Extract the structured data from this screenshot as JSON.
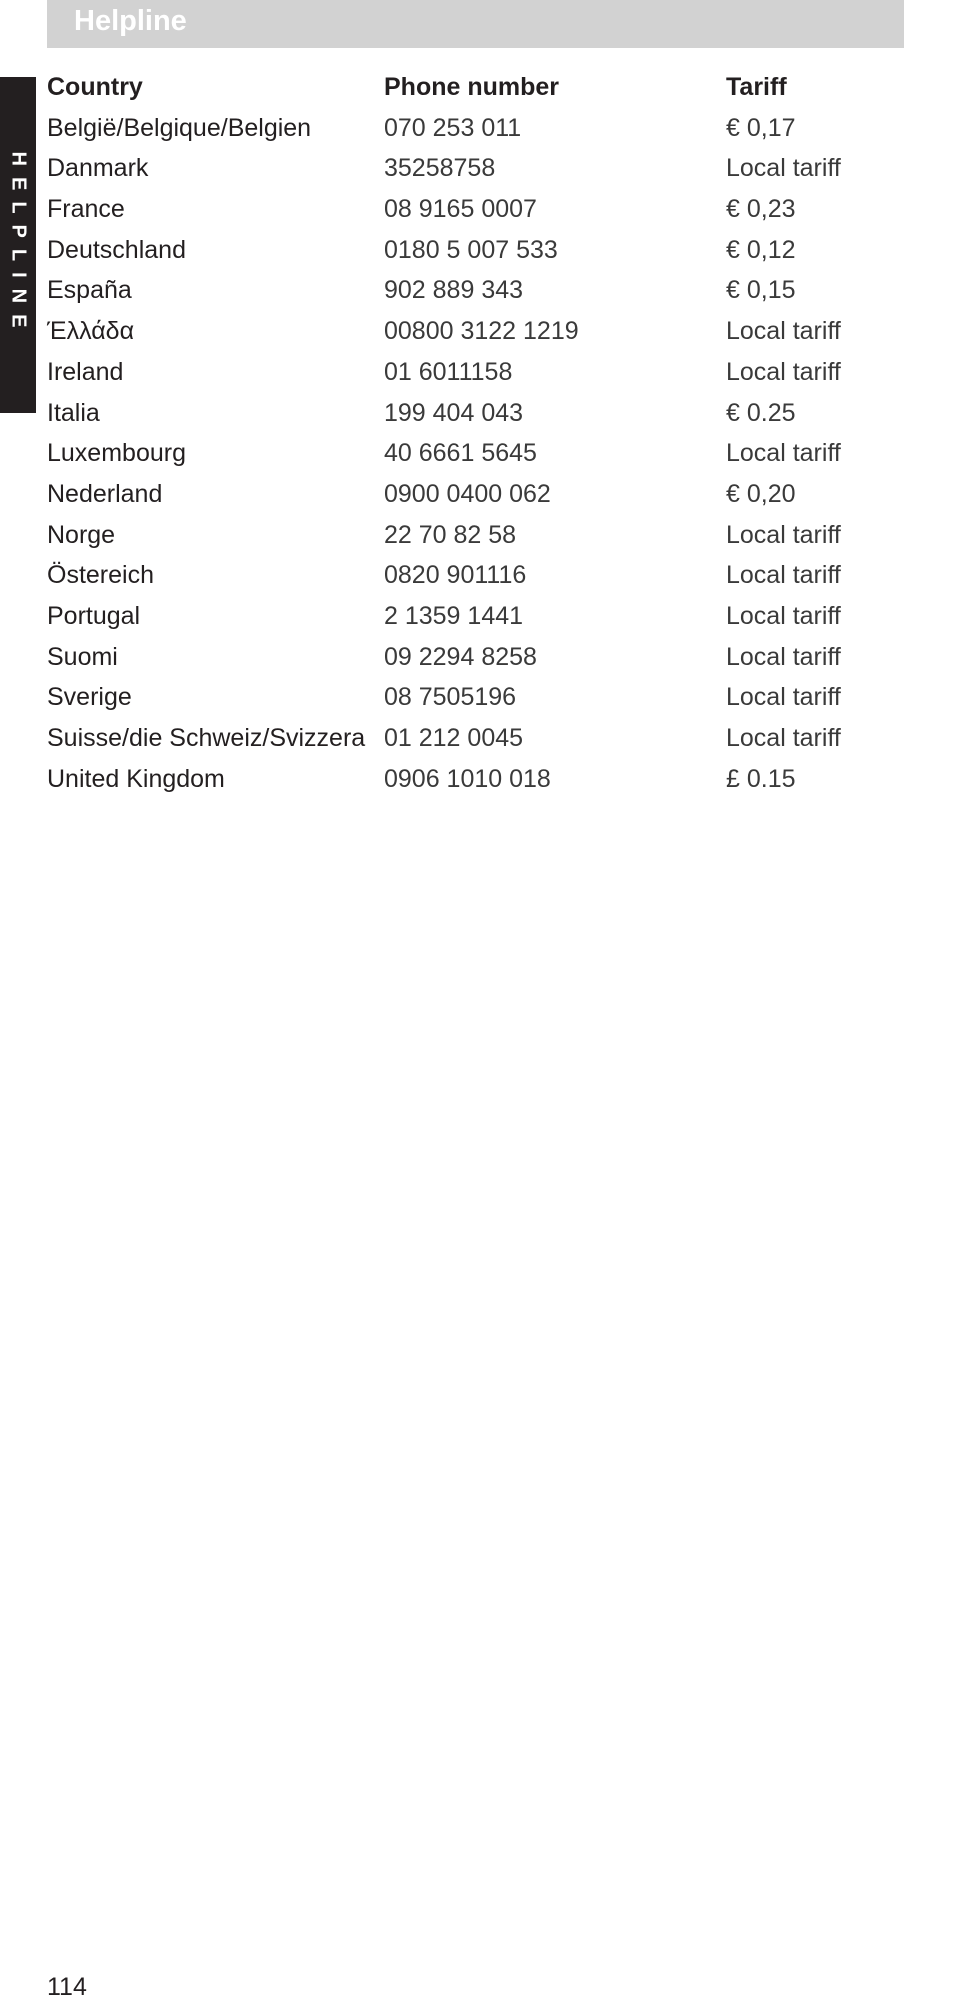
{
  "header": {
    "title": "Helpline"
  },
  "side_tab": {
    "label": "HELPLINE"
  },
  "table": {
    "columns": [
      "Country",
      "Phone number",
      "Tariff"
    ],
    "rows": [
      [
        "België/Belgique/Belgien",
        "070 253 011",
        "€ 0,17"
      ],
      [
        "Danmark",
        "35258758",
        "Local tariff"
      ],
      [
        "France",
        "08 9165 0007",
        "€ 0,23"
      ],
      [
        "Deutschland",
        "0180 5 007 533",
        "€ 0,12"
      ],
      [
        "España",
        "902 889 343",
        "€ 0,15"
      ],
      [
        "Έλλάδα",
        "00800 3122 1219",
        "Local tariff"
      ],
      [
        "Ireland",
        "01 6011158",
        "Local tariff"
      ],
      [
        "Italia",
        "199 404 043",
        "€ 0.25"
      ],
      [
        "Luxembourg",
        "40 6661 5645",
        "Local tariff"
      ],
      [
        "Nederland",
        "0900 0400 062",
        "€ 0,20"
      ],
      [
        "Norge",
        "22 70 82 58",
        "Local tariff"
      ],
      [
        "Östereich",
        "0820 901116",
        "Local tariff"
      ],
      [
        "Portugal",
        "2 1359 1441",
        "Local tariff"
      ],
      [
        "Suomi",
        "09 2294 8258",
        "Local tariff"
      ],
      [
        "Sverige",
        "08 7505196",
        "Local tariff"
      ],
      [
        "Suisse/die Schweiz/Svizzera",
        "01 212 0045",
        "Local tariff"
      ],
      [
        "United Kingdom",
        "0906 1010 018",
        "£ 0.15"
      ]
    ]
  },
  "footer": {
    "page_number": "114"
  },
  "colors": {
    "title_bar": "#d2d2d2",
    "side_tab": "#231f20",
    "text": "#231f20"
  }
}
